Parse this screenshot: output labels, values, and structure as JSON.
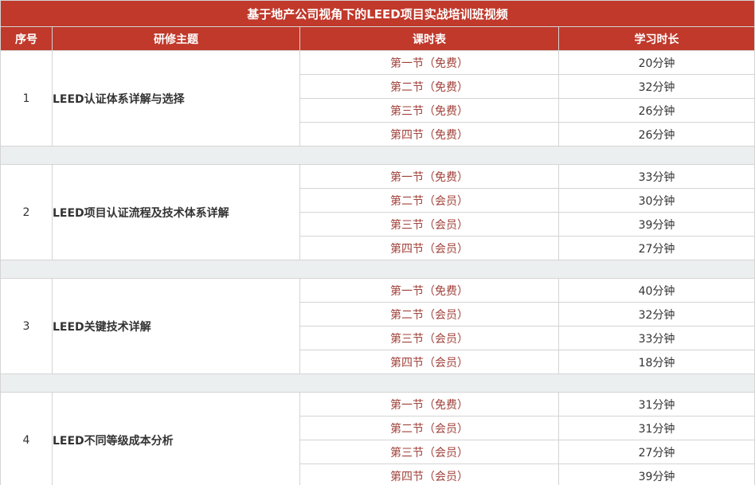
{
  "table": {
    "title": "基于地产公司视角下的LEED项目实战培训班视频",
    "headers": {
      "index": "序号",
      "topic": "研修主题",
      "schedule": "课时表",
      "duration": "学习时长"
    },
    "modules": [
      {
        "index": "1",
        "topic": "LEED认证体系详解与选择",
        "lessons": [
          {
            "label": "第一节（免费）",
            "duration": "20分钟"
          },
          {
            "label": "第二节（免费）",
            "duration": "32分钟"
          },
          {
            "label": "第三节（免费）",
            "duration": "26分钟"
          },
          {
            "label": "第四节（免费）",
            "duration": "26分钟"
          }
        ]
      },
      {
        "index": "2",
        "topic": "LEED项目认证流程及技术体系详解",
        "lessons": [
          {
            "label": "第一节（免费）",
            "duration": "33分钟"
          },
          {
            "label": "第二节（会员）",
            "duration": "30分钟"
          },
          {
            "label": "第三节（会员）",
            "duration": "39分钟"
          },
          {
            "label": "第四节（会员）",
            "duration": "27分钟"
          }
        ]
      },
      {
        "index": "3",
        "topic": "LEED关键技术详解",
        "lessons": [
          {
            "label": "第一节（免费）",
            "duration": "40分钟"
          },
          {
            "label": "第二节（会员）",
            "duration": "32分钟"
          },
          {
            "label": "第三节（会员）",
            "duration": "33分钟"
          },
          {
            "label": "第四节（会员）",
            "duration": "18分钟"
          }
        ]
      },
      {
        "index": "4",
        "topic": "LEED不同等级成本分析",
        "lessons": [
          {
            "label": "第一节（免费）",
            "duration": "31分钟"
          },
          {
            "label": "第二节（会员）",
            "duration": "31分钟"
          },
          {
            "label": "第三节（会员）",
            "duration": "27分钟"
          },
          {
            "label": "第四节（会员）",
            "duration": "39分钟"
          }
        ]
      }
    ]
  },
  "colors": {
    "header_bg": "#c0392b",
    "header_text": "#ffffff",
    "lesson_text": "#a0413a",
    "body_text": "#333333",
    "spacer_bg": "#eceff0",
    "border": "#d4d4d4"
  }
}
